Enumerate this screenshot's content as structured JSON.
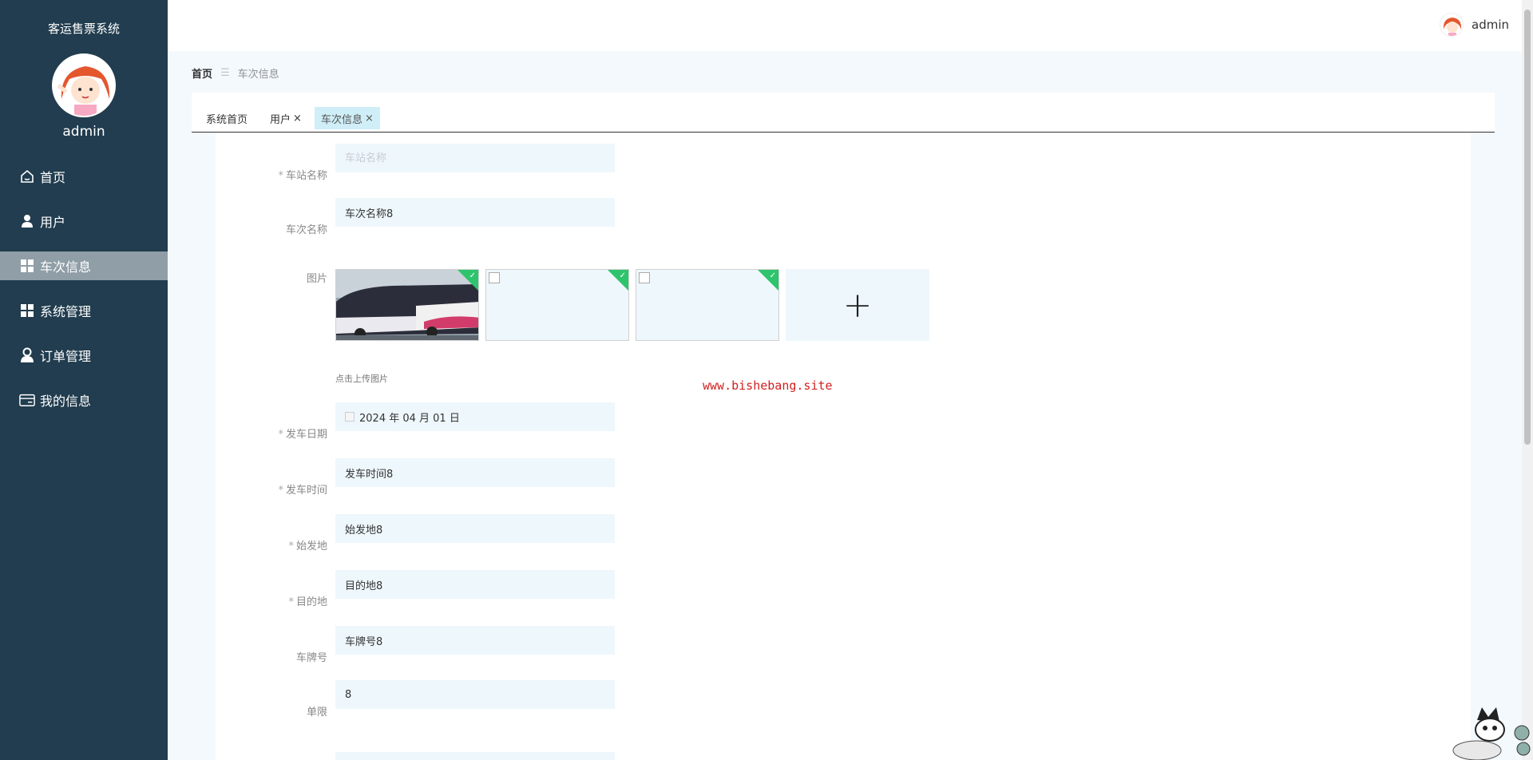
{
  "app": {
    "title": "客运售票系统",
    "admin_name": "admin"
  },
  "sidebar": {
    "items": [
      {
        "label": "首页",
        "icon": "home-icon",
        "active": false
      },
      {
        "label": "用户",
        "icon": "user-icon",
        "active": false
      },
      {
        "label": "车次信息",
        "icon": "grid-icon",
        "active": true
      },
      {
        "label": "系统管理",
        "icon": "grid-icon",
        "active": false
      },
      {
        "label": "订单管理",
        "icon": "person-icon",
        "active": false
      },
      {
        "label": "我的信息",
        "icon": "card-icon",
        "active": false
      }
    ]
  },
  "topbar": {
    "username": "admin"
  },
  "breadcrumb": {
    "home": "首页",
    "separator": "☰",
    "current": "车次信息"
  },
  "tabs": [
    {
      "label": "系统首页",
      "closable": false,
      "active": false
    },
    {
      "label": "用户",
      "closable": true,
      "active": false
    },
    {
      "label": "车次信息",
      "closable": true,
      "active": true
    }
  ],
  "form": {
    "station_name": {
      "label": "车站名称",
      "required": true,
      "placeholder": "车站名称",
      "value": ""
    },
    "train_name": {
      "label": "车次名称",
      "required": false,
      "value": "车次名称8"
    },
    "image": {
      "label": "图片",
      "upload_tip": "点击上传图片",
      "upload_symbol": "+"
    },
    "depart_date": {
      "label": "发车日期",
      "required": true,
      "value": "2024 年 04 月 01 日"
    },
    "depart_time": {
      "label": "发车时间",
      "required": true,
      "value": "发车时间8"
    },
    "origin": {
      "label": "始发地",
      "required": true,
      "value": "始发地8"
    },
    "destination": {
      "label": "目的地",
      "required": true,
      "value": "目的地8"
    },
    "plate": {
      "label": "车牌号",
      "required": false,
      "value": "车牌号8"
    },
    "limit": {
      "label": "单限",
      "required": false,
      "value": "8"
    }
  },
  "watermark": "www.bishebang.site",
  "colors": {
    "sidebar_bg": "#213d4f",
    "active_item": "#8f9ea7",
    "active_tab": "#cfeef8",
    "input_bg": "#eef7fc",
    "watermark": "#d21f1f",
    "success_corner": "#2ec46d"
  }
}
